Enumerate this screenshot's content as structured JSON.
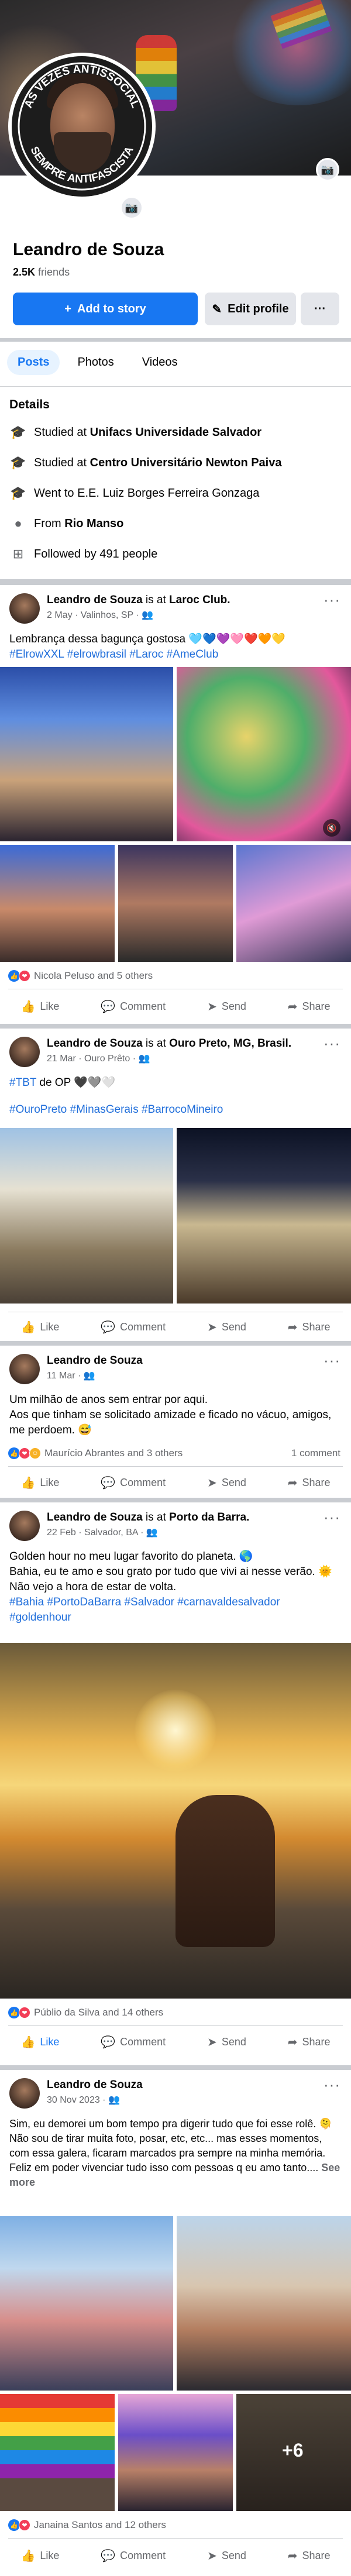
{
  "profile": {
    "name": "Leandro de Souza",
    "friends_count": "2.5K",
    "friends_label": "friends",
    "avatar_ring_top": "ÀS VEZES ANTISSOCIAL",
    "avatar_ring_bottom": "SEMPRE ANTIFASCISTA",
    "add_story_label": "Add to story",
    "edit_profile_label": "Edit profile",
    "more_label": "···"
  },
  "tabs": [
    {
      "label": "Posts",
      "active": true
    },
    {
      "label": "Photos",
      "active": false
    },
    {
      "label": "Videos",
      "active": false
    }
  ],
  "details": {
    "title": "Details",
    "rows": [
      {
        "icon": "graduation-cap-icon",
        "prefix": "Studied at ",
        "bold": "Unifacs Universidade Salvador"
      },
      {
        "icon": "graduation-cap-icon",
        "prefix": "Studied at ",
        "bold": "Centro Universitário Newton Paiva"
      },
      {
        "icon": "graduation-cap-icon",
        "prefix": "Went to E.E. Luiz Borges Ferreira Gonzaga",
        "bold": ""
      },
      {
        "icon": "location-pin-icon",
        "prefix": "From ",
        "bold": "Rio Manso"
      },
      {
        "icon": "followers-icon",
        "prefix": "Followed by 491 people",
        "bold": ""
      }
    ]
  },
  "actions": {
    "like": "Like",
    "comment": "Comment",
    "send": "Send",
    "share": "Share"
  },
  "posts": [
    {
      "author": "Leandro de Souza",
      "is_at": "is at",
      "place": "Laroc Club.",
      "meta": "2 May · Valinhos, SP ·",
      "text_line1": "Lembrança dessa bagunça gostosa 🩵💙💜🩷❤️🧡💛",
      "tags": "#ElrowXXL #elrowbrasil #Laroc #AmeClub",
      "reactions": "Nicola Peluso and 5 others"
    },
    {
      "author": "Leandro de Souza",
      "is_at": "is at",
      "place": "Ouro Preto, MG, Brasil.",
      "meta": "21 Mar · Ouro Prêto ·",
      "tbt_tag": "#TBT",
      "tbt_text": " de OP 🖤🩶🤍",
      "tags": "#OuroPreto #MinasGerais #BarrocoMineiro",
      "reactions": ""
    },
    {
      "author": "Leandro de Souza",
      "meta": "11 Mar ·",
      "text_line1": "Um milhão de anos sem entrar por aqui.",
      "text_line2": "Aos que tinham se solicitado amizade e ficado no vácuo, amigos, me perdoem. 😅",
      "reactions": "Maurício Abrantes and 3 others",
      "comments": "1 comment"
    },
    {
      "author": "Leandro de Souza",
      "is_at": "is at",
      "place": "Porto da Barra.",
      "meta": "22 Feb · Salvador, BA ·",
      "text_line1": "Golden hour no meu lugar favorito do planeta. 🌎",
      "text_line2": "Bahia, eu te amo e sou grato por tudo que vivi ai nesse verão. 🌞",
      "text_line3": "Não vejo a hora de estar de volta.",
      "tags": "#Bahia #PortoDaBarra #Salvador #carnavaldesalvador #goldenhour",
      "reactions": "Públio da Silva and 14 others"
    },
    {
      "author": "Leandro de Souza",
      "meta": "30 Nov 2023 ·",
      "text_line1": "Sim, eu demorei um bom tempo pra digerir tudo que foi esse rolê. 🫠",
      "text_line2": "Não sou de tirar muita foto, posar, etc, etc... mas esses momentos, com essa galera, ficaram marcados pra sempre na minha memória.",
      "text_line3": "Feliz em poder vivenciar tudo isso com pessoas q eu amo tanto....",
      "see_more": "See more",
      "plus_count": "+6",
      "reactions": "Janaina Santos and 12 others"
    }
  ]
}
